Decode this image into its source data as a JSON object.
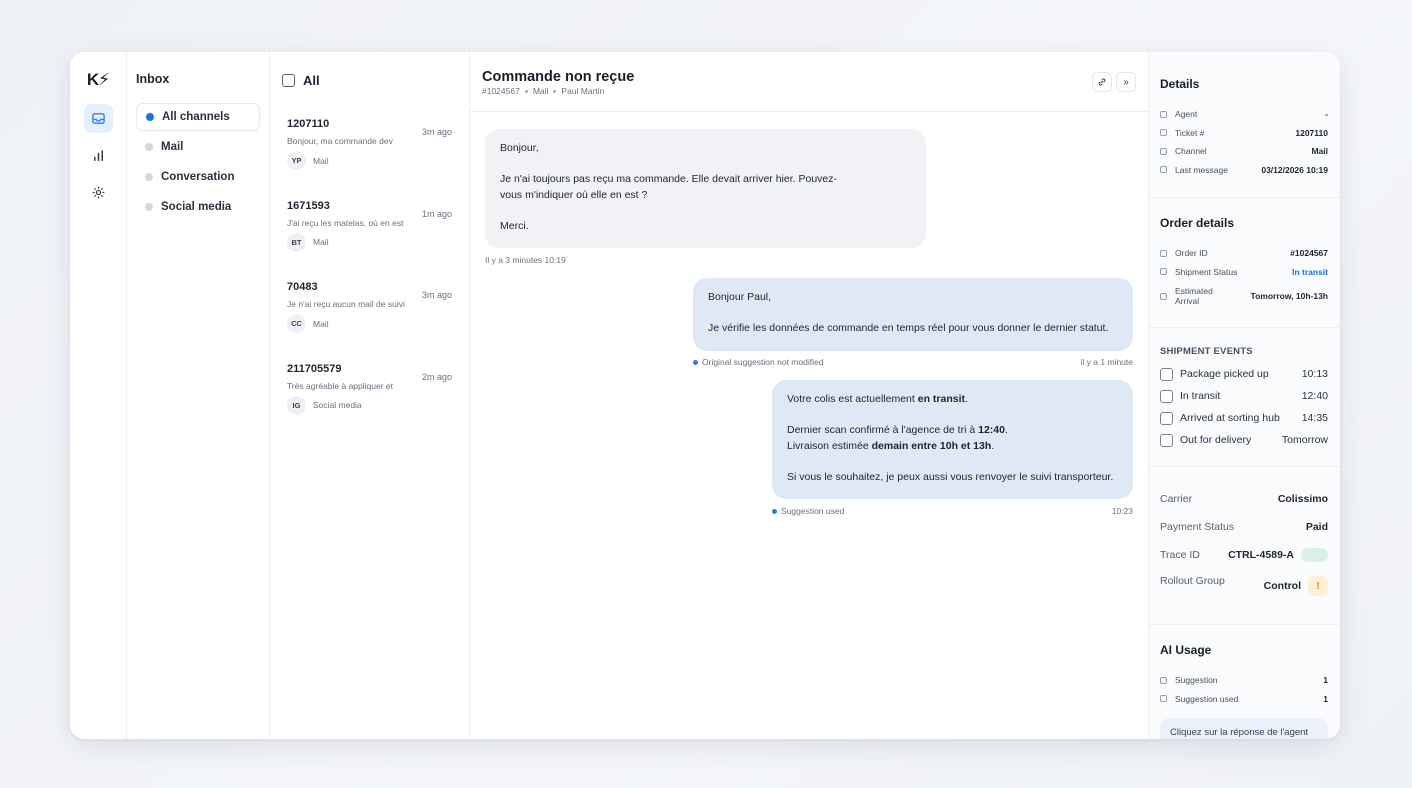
{
  "rail": {
    "logo": "K⚡"
  },
  "inbox": {
    "title": "Inbox",
    "channels": [
      {
        "label": "All channels",
        "active": true
      },
      {
        "label": "Mail",
        "active": false
      },
      {
        "label": "Conversation",
        "active": false
      },
      {
        "label": "Social media",
        "active": false
      }
    ]
  },
  "list": {
    "header_label": "All",
    "tickets": [
      {
        "id": "1207110",
        "preview": "Bonjour, ma commande dev",
        "time": "3m ago",
        "initials": "YP",
        "channel": "Mail"
      },
      {
        "id": "1671593",
        "preview": "J'ai reçu les matelas, où en est",
        "time": "1m ago",
        "initials": "BT",
        "channel": "Mail"
      },
      {
        "id": "70483",
        "preview": "Je n'ai reçu aucun mail de suivi",
        "time": "3m ago",
        "initials": "CC",
        "channel": "Mail"
      },
      {
        "id": "211705579",
        "preview": "Très agréable à appliquer et",
        "time": "2m ago",
        "initials": "IG",
        "channel": "Social media"
      }
    ]
  },
  "conversation": {
    "title": "Commande non reçue",
    "order_ref": "#1024567",
    "channel": "Mail",
    "customer": "Paul Martin",
    "incoming": {
      "line1": "Bonjour,",
      "line2": "Je n'ai toujours pas reçu ma commande. Elle devait arriver hier. Pouvez-",
      "line3": "vous m'indiquer où elle en est ?",
      "line4": "Merci.",
      "timestamp": "Il y a 3 minutes 10:19"
    },
    "reply1": {
      "line1": "Bonjour Paul,",
      "line2": "Je vérifie les données de commande en temps réel pour vous donner le dernier statut.",
      "status": "Original suggestion not modified",
      "time": "il y a 1 minute"
    },
    "reply2": {
      "l1_a": "Votre colis est actuellement ",
      "l1_b": "en transit",
      "l1_c": ".",
      "l2_a": "Dernier scan confirmé à l'agence de tri à ",
      "l2_b": "12:40",
      "l2_c": ".",
      "l3_a": "Livraison estimée ",
      "l3_b": "demain entre 10h et 13h",
      "l3_c": ".",
      "l4": "Si vous le souhaitez, je peux aussi vous renvoyer le suivi transporteur.",
      "status": "Suggestion used",
      "time": "10:23"
    }
  },
  "details": {
    "title": "Details",
    "rows": [
      {
        "label": "Agent",
        "value": "-"
      },
      {
        "label": "Ticket #",
        "value": "1207110"
      },
      {
        "label": "Channel",
        "value": "Mail"
      },
      {
        "label": "Last message",
        "value": "03/12/2026 10:19"
      }
    ]
  },
  "order": {
    "title": "Order details",
    "order_id_label": "Order ID",
    "order_id": "#1024567",
    "status_label": "Shipment Status",
    "status": "In transit",
    "status_color": "#1e6fe0",
    "eta_label_1": "Estimated",
    "eta_label_2": "Arrival",
    "eta": "Tomorrow, 10h-13h"
  },
  "shipment": {
    "title": "SHIPMENT EVENTS",
    "events": [
      {
        "label": "Package picked up",
        "time": "10:13"
      },
      {
        "label": "In transit",
        "time": "12:40"
      },
      {
        "label": "Arrived at sorting hub",
        "time": "14:35"
      },
      {
        "label": "Out for delivery",
        "time": "Tomorrow"
      }
    ]
  },
  "extra": {
    "carrier_label": "Carrier",
    "carrier": "Colissimo",
    "payment_label": "Payment Status",
    "payment": "Paid",
    "trace_label": "Trace ID",
    "trace": "CTRL-4589-A",
    "rollout_label": "Rollout Group",
    "rollout": "Control",
    "warn_glyph": "!"
  },
  "ai": {
    "title": "AI Usage",
    "rows": [
      {
        "label": "Suggestion",
        "value": "1"
      },
      {
        "label": "Suggestion used",
        "value": "1"
      }
    ],
    "hint": "Cliquez sur la réponse de l'agent"
  }
}
